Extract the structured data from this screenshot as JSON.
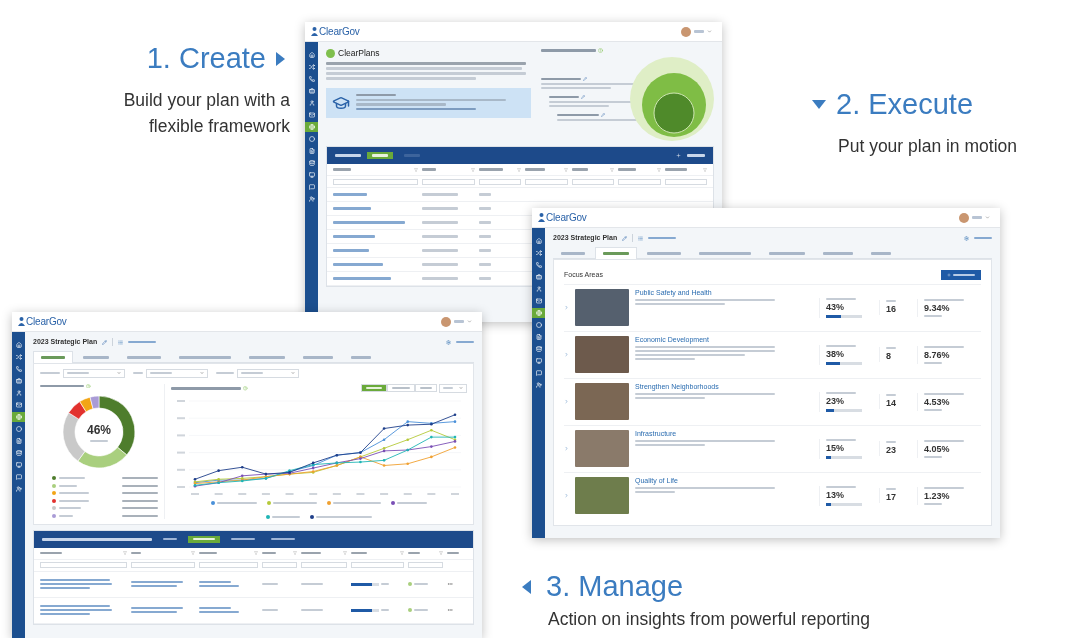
{
  "steps": [
    {
      "kind": "create",
      "title": "1. Create",
      "caption": "Build your plan with a flexible framework"
    },
    {
      "kind": "execute",
      "title": "2. Execute",
      "caption": "Put your plan in motion"
    },
    {
      "kind": "manage",
      "title": "3. Manage",
      "caption": "Action on insights from powerful reporting"
    }
  ],
  "plans_window": {
    "logo": "ClearGov",
    "nav": [
      {
        "selected": false
      },
      {
        "selected": false
      },
      {
        "selected": false
      },
      {
        "selected": false
      },
      {
        "selected": false
      },
      {
        "selected": false
      },
      {
        "selected": true
      },
      {
        "selected": false
      },
      {
        "selected": false
      },
      {
        "selected": false
      },
      {
        "selected": false
      },
      {
        "selected": false
      },
      {
        "selected": false
      }
    ],
    "title": "ClearPlans",
    "plan_filters": [
      {
        "selected": true
      },
      {
        "selected": false
      }
    ]
  },
  "manager_window": {
    "logo": "ClearGov",
    "nav": [
      {
        "selected": false
      },
      {
        "selected": false
      },
      {
        "selected": false
      },
      {
        "selected": false
      },
      {
        "selected": false
      },
      {
        "selected": false
      },
      {
        "selected": true
      },
      {
        "selected": false
      },
      {
        "selected": false
      },
      {
        "selected": false
      },
      {
        "selected": false
      },
      {
        "selected": false
      },
      {
        "selected": false
      }
    ],
    "plan_title": "2023 Strategic Plan",
    "tabs": [
      {
        "selected": false
      },
      {
        "selected": true
      },
      {
        "selected": false
      },
      {
        "selected": false
      },
      {
        "selected": false
      },
      {
        "selected": false
      },
      {
        "selected": false
      }
    ],
    "section_title": "Focus Areas",
    "focus_areas": [
      {
        "name": "Public Safety and Health",
        "progress": "43%",
        "level": 0.43,
        "goals": "16",
        "budget": "9.34%"
      },
      {
        "name": "Economic Development",
        "progress": "38%",
        "level": 0.38,
        "goals": "8",
        "budget": "8.76%"
      },
      {
        "name": "Strengthen Neighborhoods",
        "progress": "23%",
        "level": 0.23,
        "goals": "14",
        "budget": "4.53%"
      },
      {
        "name": "Infrastructure",
        "progress": "15%",
        "level": 0.15,
        "goals": "23",
        "budget": "4.05%"
      },
      {
        "name": "Quality of Life",
        "progress": "13%",
        "level": 0.13,
        "goals": "17",
        "budget": "1.23%"
      }
    ]
  },
  "dashboard_window": {
    "logo": "ClearGov",
    "nav": [
      {
        "selected": false
      },
      {
        "selected": false
      },
      {
        "selected": false
      },
      {
        "selected": false
      },
      {
        "selected": false
      },
      {
        "selected": false
      },
      {
        "selected": true
      },
      {
        "selected": false
      },
      {
        "selected": false
      },
      {
        "selected": false
      },
      {
        "selected": false
      },
      {
        "selected": false
      },
      {
        "selected": false
      }
    ],
    "plan_title": "2023 Strategic Plan",
    "tabs": [
      {
        "selected": true
      },
      {
        "selected": false
      },
      {
        "selected": false
      },
      {
        "selected": false
      },
      {
        "selected": false
      },
      {
        "selected": false
      },
      {
        "selected": false
      }
    ],
    "status": {
      "percent": "46%",
      "legend": [
        {
          "color": "#4e7d2c"
        },
        {
          "color": "#a9cf7e"
        },
        {
          "color": "#f2a516"
        },
        {
          "color": "#e2312d"
        },
        {
          "color": "#c9c9c9"
        },
        {
          "color": "#a99bd6"
        }
      ]
    },
    "periods": [
      {
        "selected": true
      },
      {
        "selected": false
      },
      {
        "selected": false
      }
    ],
    "chart_legend": [
      {
        "color": "#4a90d9"
      },
      {
        "color": "#b5c93a"
      },
      {
        "color": "#f0a030"
      },
      {
        "color": "#7a4fb5"
      },
      {
        "color": "#1fb5b5"
      },
      {
        "color": "#1f3f8a"
      }
    ],
    "ranges": [
      {
        "selected": false
      },
      {
        "selected": true
      },
      {
        "selected": false
      },
      {
        "selected": false
      }
    ],
    "checkin_rows": [
      {
        "level": 0.75
      },
      {
        "level": 0.75
      }
    ]
  }
}
